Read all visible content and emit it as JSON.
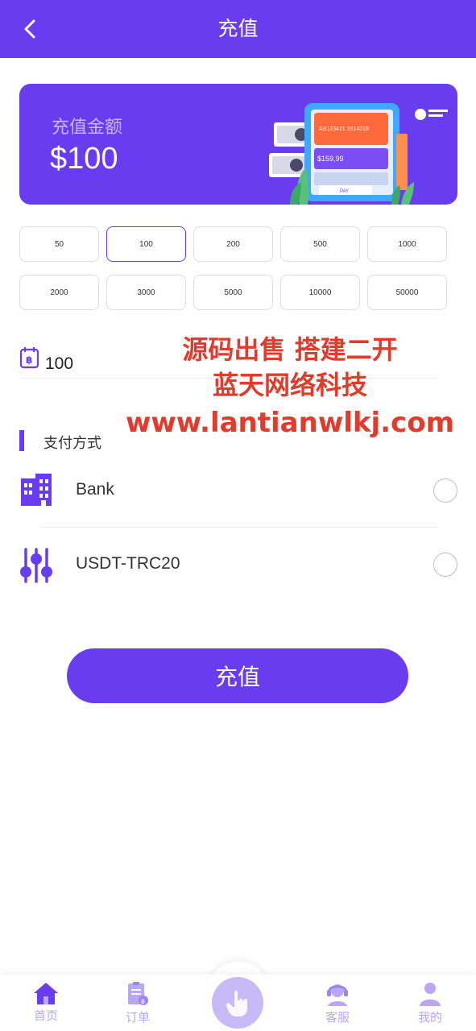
{
  "header": {
    "title": "充值"
  },
  "banner": {
    "label": "充值金额",
    "amount": "$100",
    "art_card_number": "AB123421 3514215",
    "art_price": "$159,99",
    "art_pay": "PAY"
  },
  "amounts": [
    "50",
    "100",
    "200",
    "500",
    "1000",
    "2000",
    "3000",
    "5000",
    "10000",
    "50000"
  ],
  "selected_amount": "100",
  "amount_input": {
    "value": "100"
  },
  "watermark": {
    "line1": "源码出售 搭建二开",
    "line2": "蓝天网络科技",
    "line3": "www.lantianwlkj.com"
  },
  "payment": {
    "section_title": "支付方式",
    "methods": [
      {
        "label": "Bank",
        "icon": "bank-building-icon"
      },
      {
        "label": "USDT-TRC20",
        "icon": "sliders-icon"
      }
    ]
  },
  "submit": {
    "label": "充值"
  },
  "tabbar": {
    "items": [
      {
        "label": "首页",
        "icon": "home-icon"
      },
      {
        "label": "订单",
        "icon": "orders-icon"
      },
      {
        "label": "",
        "icon": "hand-tap-icon"
      },
      {
        "label": "客服",
        "icon": "customer-service-icon"
      },
      {
        "label": "我的",
        "icon": "user-icon"
      }
    ]
  },
  "colors": {
    "primary": "#6a3cf0",
    "tab_inactive": "#b9a7f5",
    "watermark": "#e23b2b"
  }
}
